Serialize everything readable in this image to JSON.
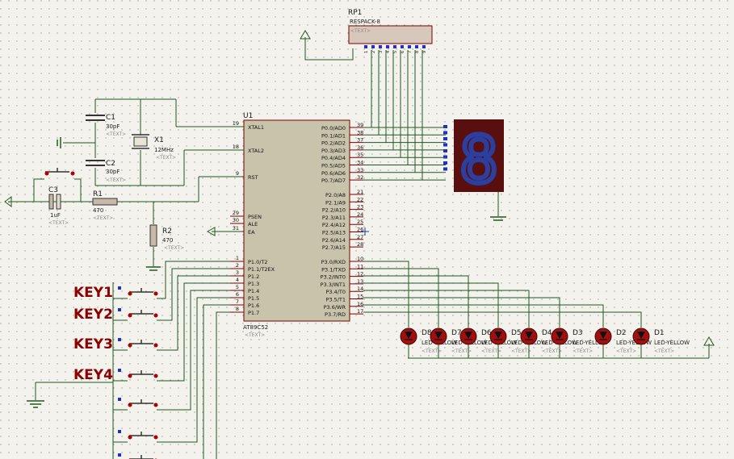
{
  "rp1": {
    "ref": "RP1",
    "value": "RESPACK-8",
    "text": "<TEXT>",
    "pins": [
      "1",
      "2",
      "3",
      "4",
      "5",
      "6",
      "7",
      "8",
      "9"
    ]
  },
  "u1": {
    "ref": "U1",
    "part": "AT89C52",
    "text": "<TEXT>",
    "left_pins": [
      {
        "num": "19",
        "name": "XTAL1"
      },
      {
        "num": "18",
        "name": "XTAL2"
      },
      {
        "num": "9",
        "name": "RST"
      },
      {
        "num": "29",
        "name": "PSEN"
      },
      {
        "num": "30",
        "name": "ALE"
      },
      {
        "num": "31",
        "name": "EA"
      },
      {
        "num": "1",
        "name": "P1.0/T2"
      },
      {
        "num": "2",
        "name": "P1.1/T2EX"
      },
      {
        "num": "3",
        "name": "P1.2"
      },
      {
        "num": "4",
        "name": "P1.3"
      },
      {
        "num": "5",
        "name": "P1.4"
      },
      {
        "num": "6",
        "name": "P1.5"
      },
      {
        "num": "7",
        "name": "P1.6"
      },
      {
        "num": "8",
        "name": "P1.7"
      }
    ],
    "right_p0": [
      {
        "num": "39",
        "name": "P0.0/AD0"
      },
      {
        "num": "38",
        "name": "P0.1/AD1"
      },
      {
        "num": "37",
        "name": "P0.2/AD2"
      },
      {
        "num": "36",
        "name": "P0.3/AD3"
      },
      {
        "num": "35",
        "name": "P0.4/AD4"
      },
      {
        "num": "34",
        "name": "P0.5/AD5"
      },
      {
        "num": "33",
        "name": "P0.6/AD6"
      },
      {
        "num": "32",
        "name": "P0.7/AD7"
      }
    ],
    "right_p2": [
      {
        "num": "21",
        "name": "P2.0/A8"
      },
      {
        "num": "22",
        "name": "P2.1/A9"
      },
      {
        "num": "23",
        "name": "P2.2/A10"
      },
      {
        "num": "24",
        "name": "P2.3/A11"
      },
      {
        "num": "25",
        "name": "P2.4/A12"
      },
      {
        "num": "26",
        "name": "P2.5/A13"
      },
      {
        "num": "27",
        "name": "P2.6/A14"
      },
      {
        "num": "28",
        "name": "P2.7/A15"
      }
    ],
    "right_p3": [
      {
        "num": "10",
        "name": "P3.0/RXD"
      },
      {
        "num": "11",
        "name": "P3.1/TXD"
      },
      {
        "num": "12",
        "name": "P3.2/INT0"
      },
      {
        "num": "13",
        "name": "P3.3/INT1"
      },
      {
        "num": "14",
        "name": "P3.4/T0"
      },
      {
        "num": "15",
        "name": "P3.5/T1"
      },
      {
        "num": "16",
        "name": "P3.6/WR"
      },
      {
        "num": "17",
        "name": "P3.7/RD"
      }
    ]
  },
  "c1": {
    "ref": "C1",
    "value": "30pF",
    "text": "<TEXT>"
  },
  "c2": {
    "ref": "C2",
    "value": "30pF",
    "text": "<TEXT>"
  },
  "x1": {
    "ref": "X1",
    "value": "12MHz",
    "text": "<TEXT>"
  },
  "c3": {
    "ref": "C3",
    "value": "1uF",
    "text": "<TEXT>"
  },
  "r1": {
    "ref": "R1",
    "value": "470",
    "text": "<TEXT>"
  },
  "r2": {
    "ref": "R2",
    "value": "470",
    "text": "<TEXT>"
  },
  "keys": [
    "KEY1",
    "KEY2",
    "KEY3",
    "KEY4"
  ],
  "leds": [
    {
      "ref": "D8",
      "label": "LED-YELLOW"
    },
    {
      "ref": "D7",
      "label": "LED-YELLOW"
    },
    {
      "ref": "D6",
      "label": "LED-YELLOW"
    },
    {
      "ref": "D5",
      "label": "LED-YELLOW"
    },
    {
      "ref": "D4",
      "label": "LED-YELLOW"
    },
    {
      "ref": "D3",
      "label": "LED-YELLOW"
    },
    {
      "ref": "D2",
      "label": "LED-YELLOW"
    },
    {
      "ref": "D1",
      "label": "LED-YELLOW"
    }
  ],
  "led_text": "<TEXT>",
  "seg_digit": "8",
  "colors": {
    "wire": "#1e5a1e",
    "chip_fill": "#c8c4ac",
    "chip_border": "#7a0000",
    "seg_bg": "#5a0f0f",
    "seg_on": "#2b3fa0",
    "key_label": "#8b0000",
    "led": "#a01010"
  }
}
